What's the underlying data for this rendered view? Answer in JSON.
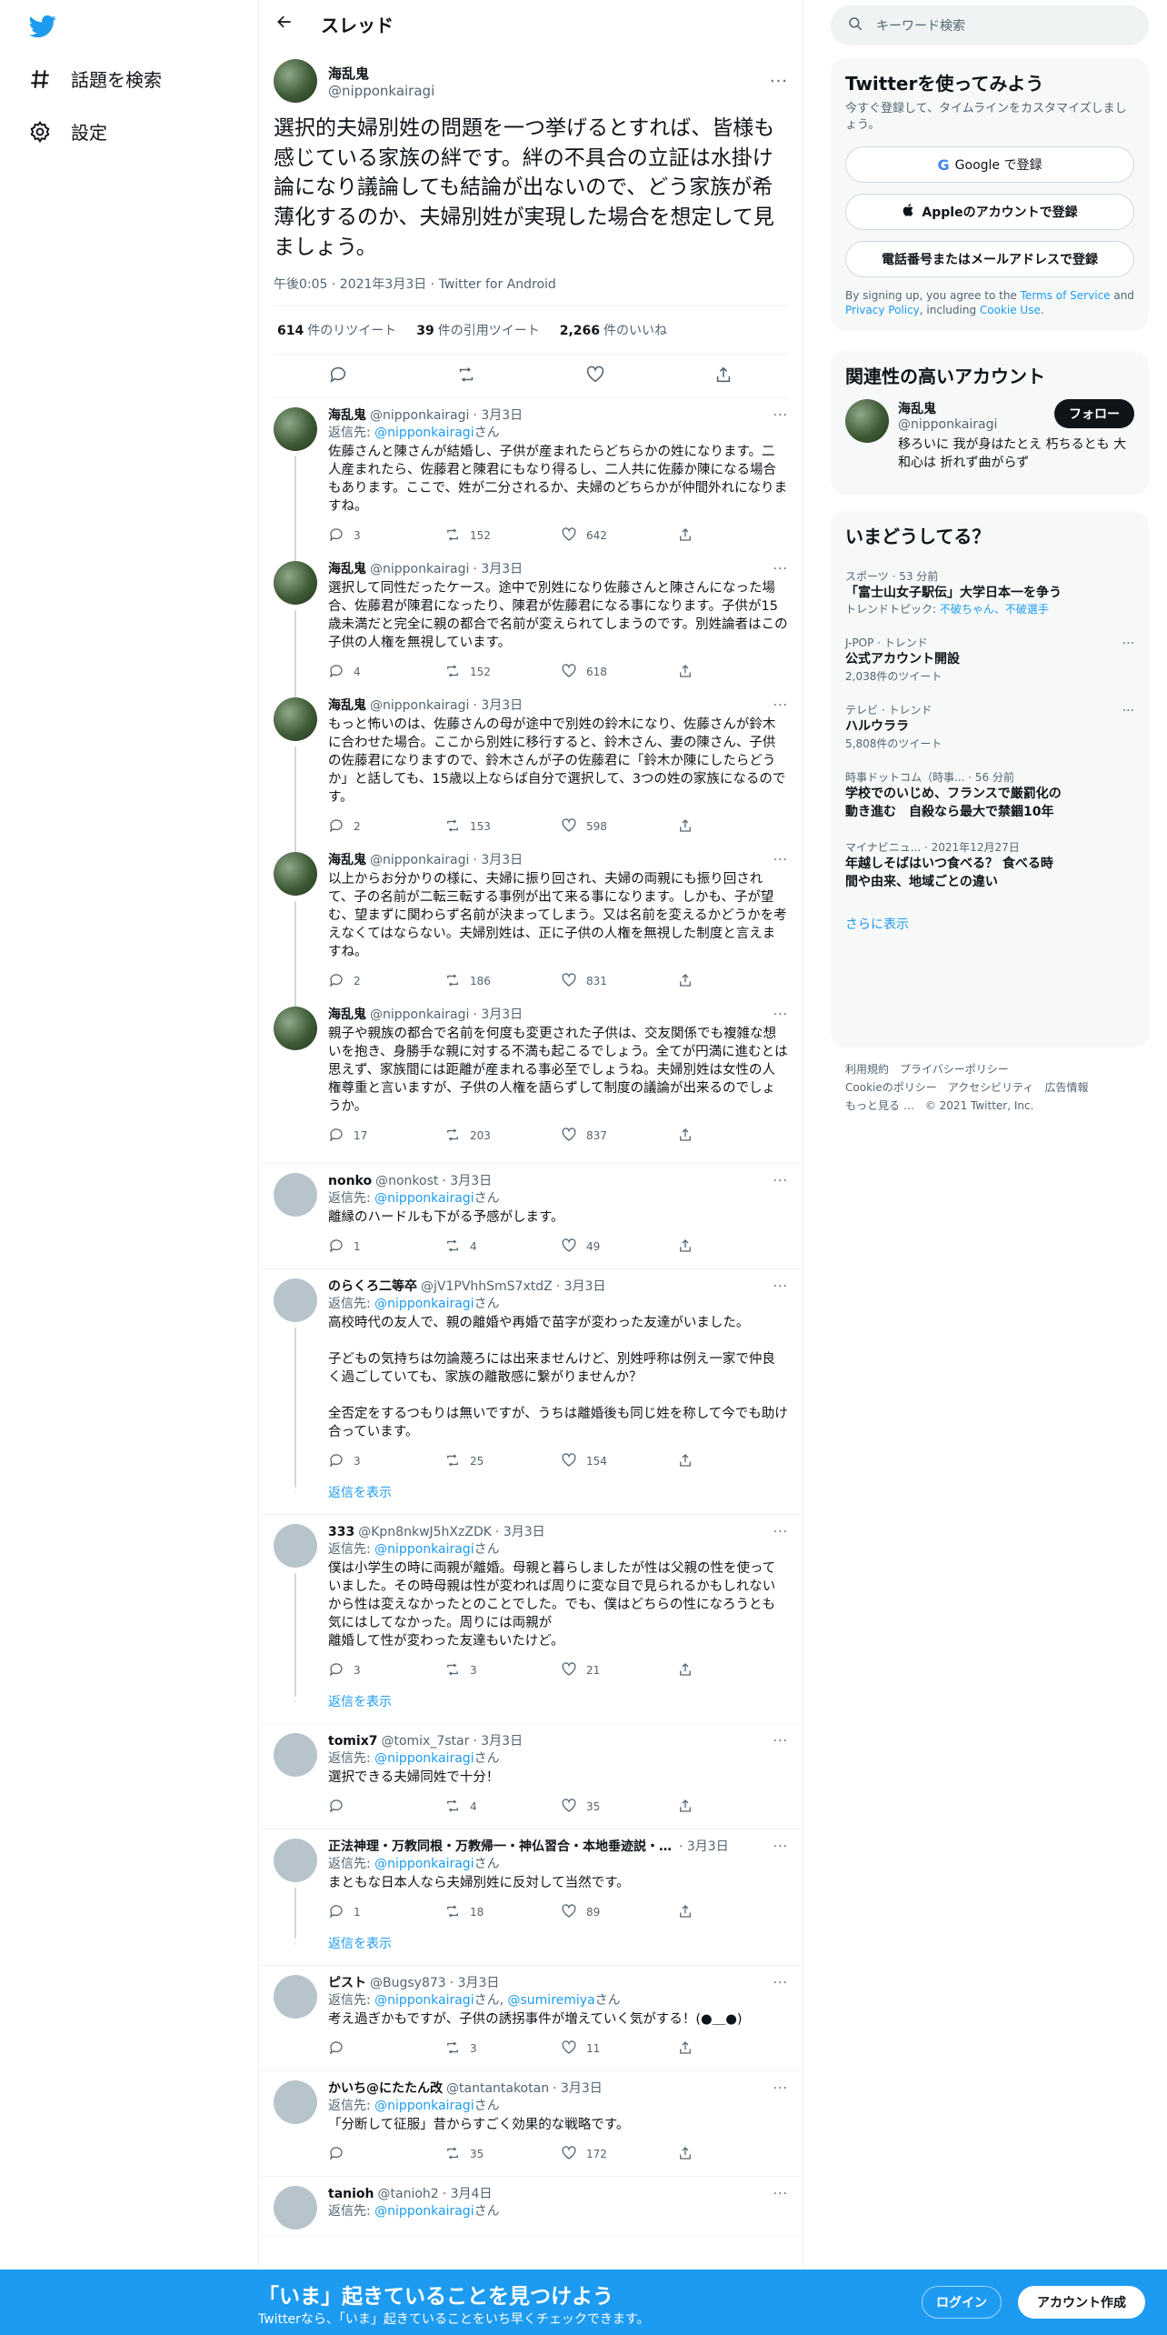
{
  "nav": {
    "explore_label": "話題を検索",
    "settings_label": "設定"
  },
  "header": {
    "title": "スレッド"
  },
  "focal": {
    "name": "海乱鬼",
    "handle": "@nipponkairagi",
    "text": "選択的夫婦別姓の問題を一つ挙げるとすれば、皆様も感じている家族の絆です。絆の不具合の立証は水掛け論になり議論しても結論が出ないので、どう家族が希薄化するのか、夫婦別姓が実現した場合を想定して見ましょう。",
    "meta": "午後0:05 · 2021年3月3日 · Twitter for Android",
    "retweets": "614",
    "retweets_label": "件のリツイート",
    "quotes": "39",
    "quotes_label": "件の引用ツイート",
    "likes": "2,266",
    "likes_label": "件のいいね"
  },
  "tweets": [
    {
      "name": "海乱鬼",
      "handle": "@nipponkairagi",
      "date": "· 3月3日",
      "reply_prefix": "返信先: ",
      "reply_to": "@nipponkairagi",
      "reply_suffix": "さん",
      "text": "佐藤さんと陳さんが結婚し、子供が産まれたらどちらかの姓になります。二人産まれたら、佐藤君と陳君にもなり得るし、二人共に佐藤か陳になる場合もあります。ここで、姓が二分されるか、夫婦のどちらかが仲間外れになりますね。",
      "replies": "3",
      "retweets": "152",
      "likes": "642"
    },
    {
      "name": "海乱鬼",
      "handle": "@nipponkairagi",
      "date": "· 3月3日",
      "text": "選択して同性だったケース。途中で別姓になり佐藤さんと陳さんになった場合、佐藤君が陳君になったり、陳君が佐藤君になる事になります。子供が15歳未満だと完全に親の都合で名前が変えられてしまうのです。別姓論者はこの子供の人権を無視しています。",
      "replies": "4",
      "retweets": "152",
      "likes": "618"
    },
    {
      "name": "海乱鬼",
      "handle": "@nipponkairagi",
      "date": "· 3月3日",
      "text": "もっと怖いのは、佐藤さんの母が途中で別姓の鈴木になり、佐藤さんが鈴木に合わせた場合。ここから別姓に移行すると、鈴木さん、妻の陳さん、子供の佐藤君になりますので、鈴木さんが子の佐藤君に「鈴木か陳にしたらどうか」と話しても、15歳以上ならば自分で選択して、3つの姓の家族になるのです。",
      "replies": "2",
      "retweets": "153",
      "likes": "598"
    },
    {
      "name": "海乱鬼",
      "handle": "@nipponkairagi",
      "date": "· 3月3日",
      "text": "以上からお分かりの様に、夫婦に振り回され、夫婦の両親にも振り回されて、子の名前が二転三転する事例が出て来る事になります。しかも、子が望む、望まずに関わらず名前が決まってしまう。又は名前を変えるかどうかを考えなくてはならない。夫婦別姓は、正に子供の人権を無視した制度と言えますね。",
      "replies": "2",
      "retweets": "186",
      "likes": "831"
    },
    {
      "name": "海乱鬼",
      "handle": "@nipponkairagi",
      "date": "· 3月3日",
      "text": "親子や親族の都合で名前を何度も変更された子供は、交友関係でも複雑な想いを抱き、身勝手な親に対する不満も起こるでしょう。全てが円満に進むとは思えず、家族間には距離が産まれる事必至でしょうね。夫婦別姓は女性の人権尊重と言いますが、子供の人権を語らずして制度の議論が出来るのでしょうか。",
      "replies": "17",
      "retweets": "203",
      "likes": "837"
    },
    {
      "name": "nonko",
      "handle": "@nonkost",
      "date": "· 3月3日",
      "reply_prefix": "返信先: ",
      "reply_to": "@nipponkairagi",
      "reply_suffix": "さん",
      "text": "離縁のハードルも下がる予感がします。",
      "replies": "1",
      "retweets": "4",
      "likes": "49"
    },
    {
      "name": "のらくろ二等卒",
      "handle": "@jV1PVhhSmS7xtdZ",
      "date": "· 3月3日",
      "reply_prefix": "返信先: ",
      "reply_to": "@nipponkairagi",
      "reply_suffix": "さん",
      "text": "高校時代の友人で、親の離婚や再婚で苗字が変わった友達がいました。\n\n子どもの気持ちは勿論蔑ろには出来ませんけど、別姓呼称は例え一家で仲良く過ごしていても、家族の離散感に繋がりませんか？\n\n全否定をするつもりは無いですが、うちは離婚後も同じ姓を称して今でも助け合っています。",
      "replies": "3",
      "retweets": "25",
      "likes": "154",
      "show_replies": "返信を表示"
    },
    {
      "name": "333",
      "handle": "@Kpn8nkwJ5hXzZDK",
      "date": "· 3月3日",
      "reply_prefix": "返信先: ",
      "reply_to": "@nipponkairagi",
      "reply_suffix": "さん",
      "text": "僕は小学生の時に両親が離婚。母親と暮らしましたが性は父親の性を使っていました。その時母親は性が変われば周りに変な目で見られるかもしれないから性は変えなかったとのことでした。でも、僕はどちらの性になろうとも気にはしてなかった。周りには両親が\n離婚して性が変わった友達もいたけど。",
      "replies": "3",
      "retweets": "3",
      "likes": "21",
      "show_replies": "返信を表示"
    },
    {
      "name": "tomix7",
      "handle": "@tomix_7star",
      "date": "· 3月3日",
      "reply_prefix": "返信先: ",
      "reply_to": "@nipponkairagi",
      "reply_suffix": "さん",
      "text": "選択できる夫婦同姓で十分！",
      "replies": "",
      "retweets": "4",
      "likes": "35"
    },
    {
      "name": "正法神理・万教同根・万教帰一・神仏習合・本地垂迹説・…",
      "handle": "",
      "date": "· 3月3日",
      "reply_prefix": "返信先: ",
      "reply_to": "@nipponkairagi",
      "reply_suffix": "さん",
      "text": "まともな日本人なら夫婦別姓に反対して当然です。",
      "replies": "1",
      "retweets": "18",
      "likes": "89",
      "show_replies": "返信を表示"
    },
    {
      "name": "ピスト",
      "handle": "@Bugsy873",
      "date": "· 3月3日",
      "reply_prefix": "返信先: ",
      "reply_to": "@nipponkairagi",
      "reply_mid": "さん, ",
      "reply_to2": "@sumiremiya",
      "reply_suffix": "さん",
      "text": "考え過ぎかもですが、子供の誘拐事件が増えていく気がする！(●＿●)",
      "replies": "",
      "retweets": "3",
      "likes": "11"
    },
    {
      "name": "かいち@にたたん改",
      "handle": "@tantantakotan",
      "date": "· 3月3日",
      "reply_prefix": "返信先: ",
      "reply_to": "@nipponkairagi",
      "reply_suffix": "さん",
      "text": "「分断して征服」昔からすごく効果的な戦略です。",
      "replies": "",
      "retweets": "35",
      "likes": "172"
    },
    {
      "name": "tanioh",
      "handle": "@tanioh2",
      "date": "· 3月4日",
      "reply_prefix": "返信先: ",
      "reply_to": "@nipponkairagi",
      "reply_suffix": "さん",
      "text": "",
      "replies": "",
      "retweets": "",
      "likes": ""
    }
  ],
  "search": {
    "placeholder": "キーワード検索"
  },
  "signup": {
    "title": "Twitterを使ってみよう",
    "subtitle": "今すぐ登録して、タイムラインをカスタマイズしましょう。",
    "google_label": "Google で登録",
    "apple_label": "Appleのアカウントで登録",
    "phone_label": "電話番号またはメールアドレスで登録",
    "legal_1": "By signing up, you agree to the ",
    "terms": "Terms of Service",
    "legal_2": " and ",
    "privacy": "Privacy Policy",
    "legal_3": ", including ",
    "cookie": "Cookie Use",
    "legal_4": "."
  },
  "related": {
    "title": "関連性の高いアカウント",
    "name": "海乱鬼",
    "handle": "@nipponkairagi",
    "follow_label": "フォロー",
    "bio": "移ろいに 我が身はたとえ 朽ちるとも 大和心は 折れず曲がらず"
  },
  "trends": {
    "title": "いまどうしてる？",
    "items": [
      {
        "meta": "スポーツ · 53 分前",
        "title": "「富士山女子駅伝」大学日本一を争う",
        "topic_prefix": "トレンドトピック: ",
        "topic": "不破ちゃん、不破選手"
      },
      {
        "meta": "J-POP · トレンド",
        "title": "公式アカウント開設",
        "count": "2,038件のツイート"
      },
      {
        "meta": "テレビ · トレンド",
        "title": "ハルウララ",
        "count": "5,808件のツイート"
      },
      {
        "meta": "時事ドットコム（時事... · 56 分前",
        "title": "学校でのいじめ、フランスで厳罰化の動き進む　自殺なら最大で禁錮10年"
      },
      {
        "meta": "マイナビニュ... · 2021年12月27日",
        "title": "年越しそばはいつ食べる？ 食べる時間や由来、地域ごとの違い"
      }
    ],
    "show_more": "さらに表示"
  },
  "footer": {
    "terms": "利用規約",
    "privacy": "プライバシーポリシー",
    "cookie": "Cookieのポリシー",
    "accessibility": "アクセシビリティ",
    "ads": "広告情報",
    "more": "もっと見る …",
    "copyright": "© 2021 Twitter, Inc."
  },
  "bottom": {
    "title": "「いま」起きていることを見つけよう",
    "subtitle": "Twitterなら、「いま」起きていることをいち早くチェックできます。",
    "login": "ログイン",
    "signup": "アカウント作成"
  },
  "colors": {
    "accent": "#1d9bf0",
    "text": "#0f1419",
    "muted": "#536471"
  }
}
